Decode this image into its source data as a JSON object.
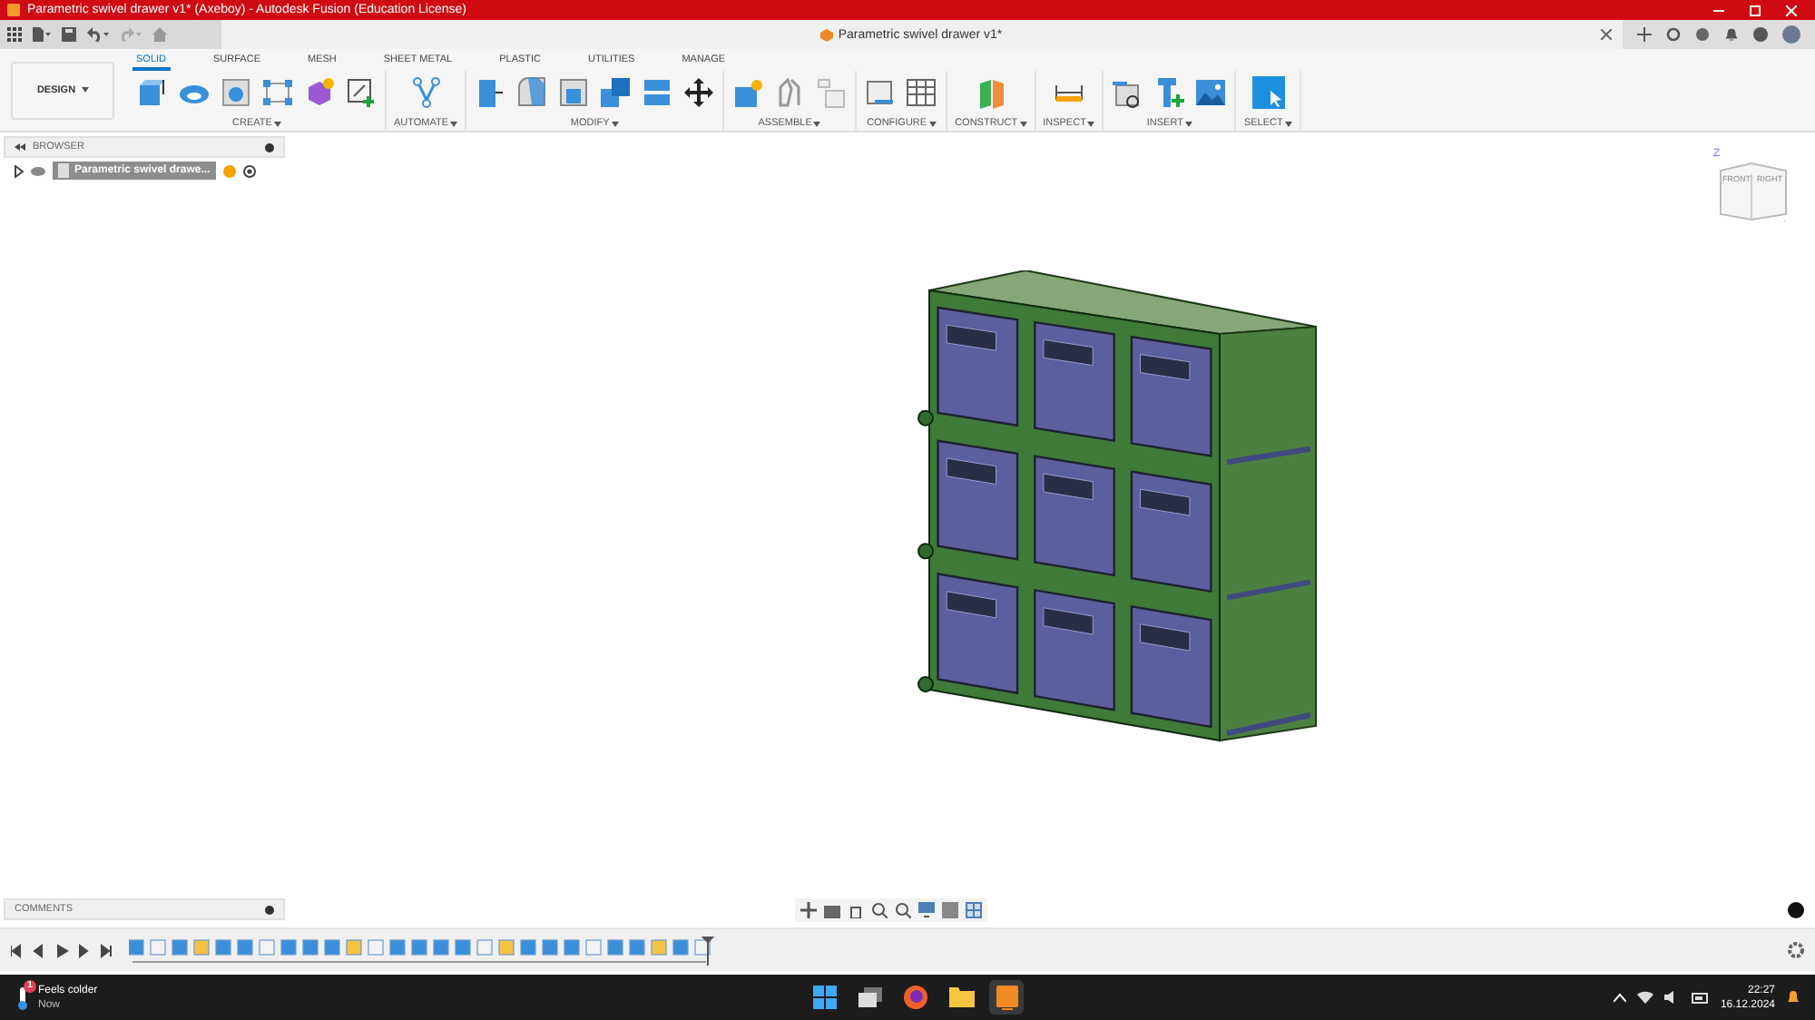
{
  "window": {
    "title": "Parametric swivel drawer v1* (Axeboy) - Autodesk Fusion (Education License)"
  },
  "document_tab": {
    "title": "Parametric swivel drawer v1*"
  },
  "ribbon": {
    "workspace": "DESIGN",
    "tabs": [
      {
        "label": "SOLID",
        "selected": true
      },
      {
        "label": "SURFACE",
        "selected": false
      },
      {
        "label": "MESH",
        "selected": false
      },
      {
        "label": "SHEET METAL",
        "selected": false
      },
      {
        "label": "PLASTIC",
        "selected": false
      },
      {
        "label": "UTILITIES",
        "selected": false
      },
      {
        "label": "MANAGE",
        "selected": false
      }
    ],
    "groups": [
      {
        "label": "CREATE"
      },
      {
        "label": "AUTOMATE"
      },
      {
        "label": "MODIFY"
      },
      {
        "label": "ASSEMBLE"
      },
      {
        "label": "CONFIGURE"
      },
      {
        "label": "CONSTRUCT"
      },
      {
        "label": "INSPECT"
      },
      {
        "label": "INSERT"
      },
      {
        "label": "SELECT"
      }
    ]
  },
  "browser": {
    "title": "BROWSER",
    "items": [
      {
        "label": "Parametric swivel drawe...",
        "selected": true
      }
    ]
  },
  "view_cube": {
    "axis": "Z",
    "front": "FRONT",
    "right": "RIGHT"
  },
  "comments": {
    "title": "COMMENTS"
  },
  "taskbar": {
    "weather": "Feels colder",
    "weather_time": "Now",
    "badge": "1",
    "time": "22:27",
    "date": "16.12.2024"
  }
}
